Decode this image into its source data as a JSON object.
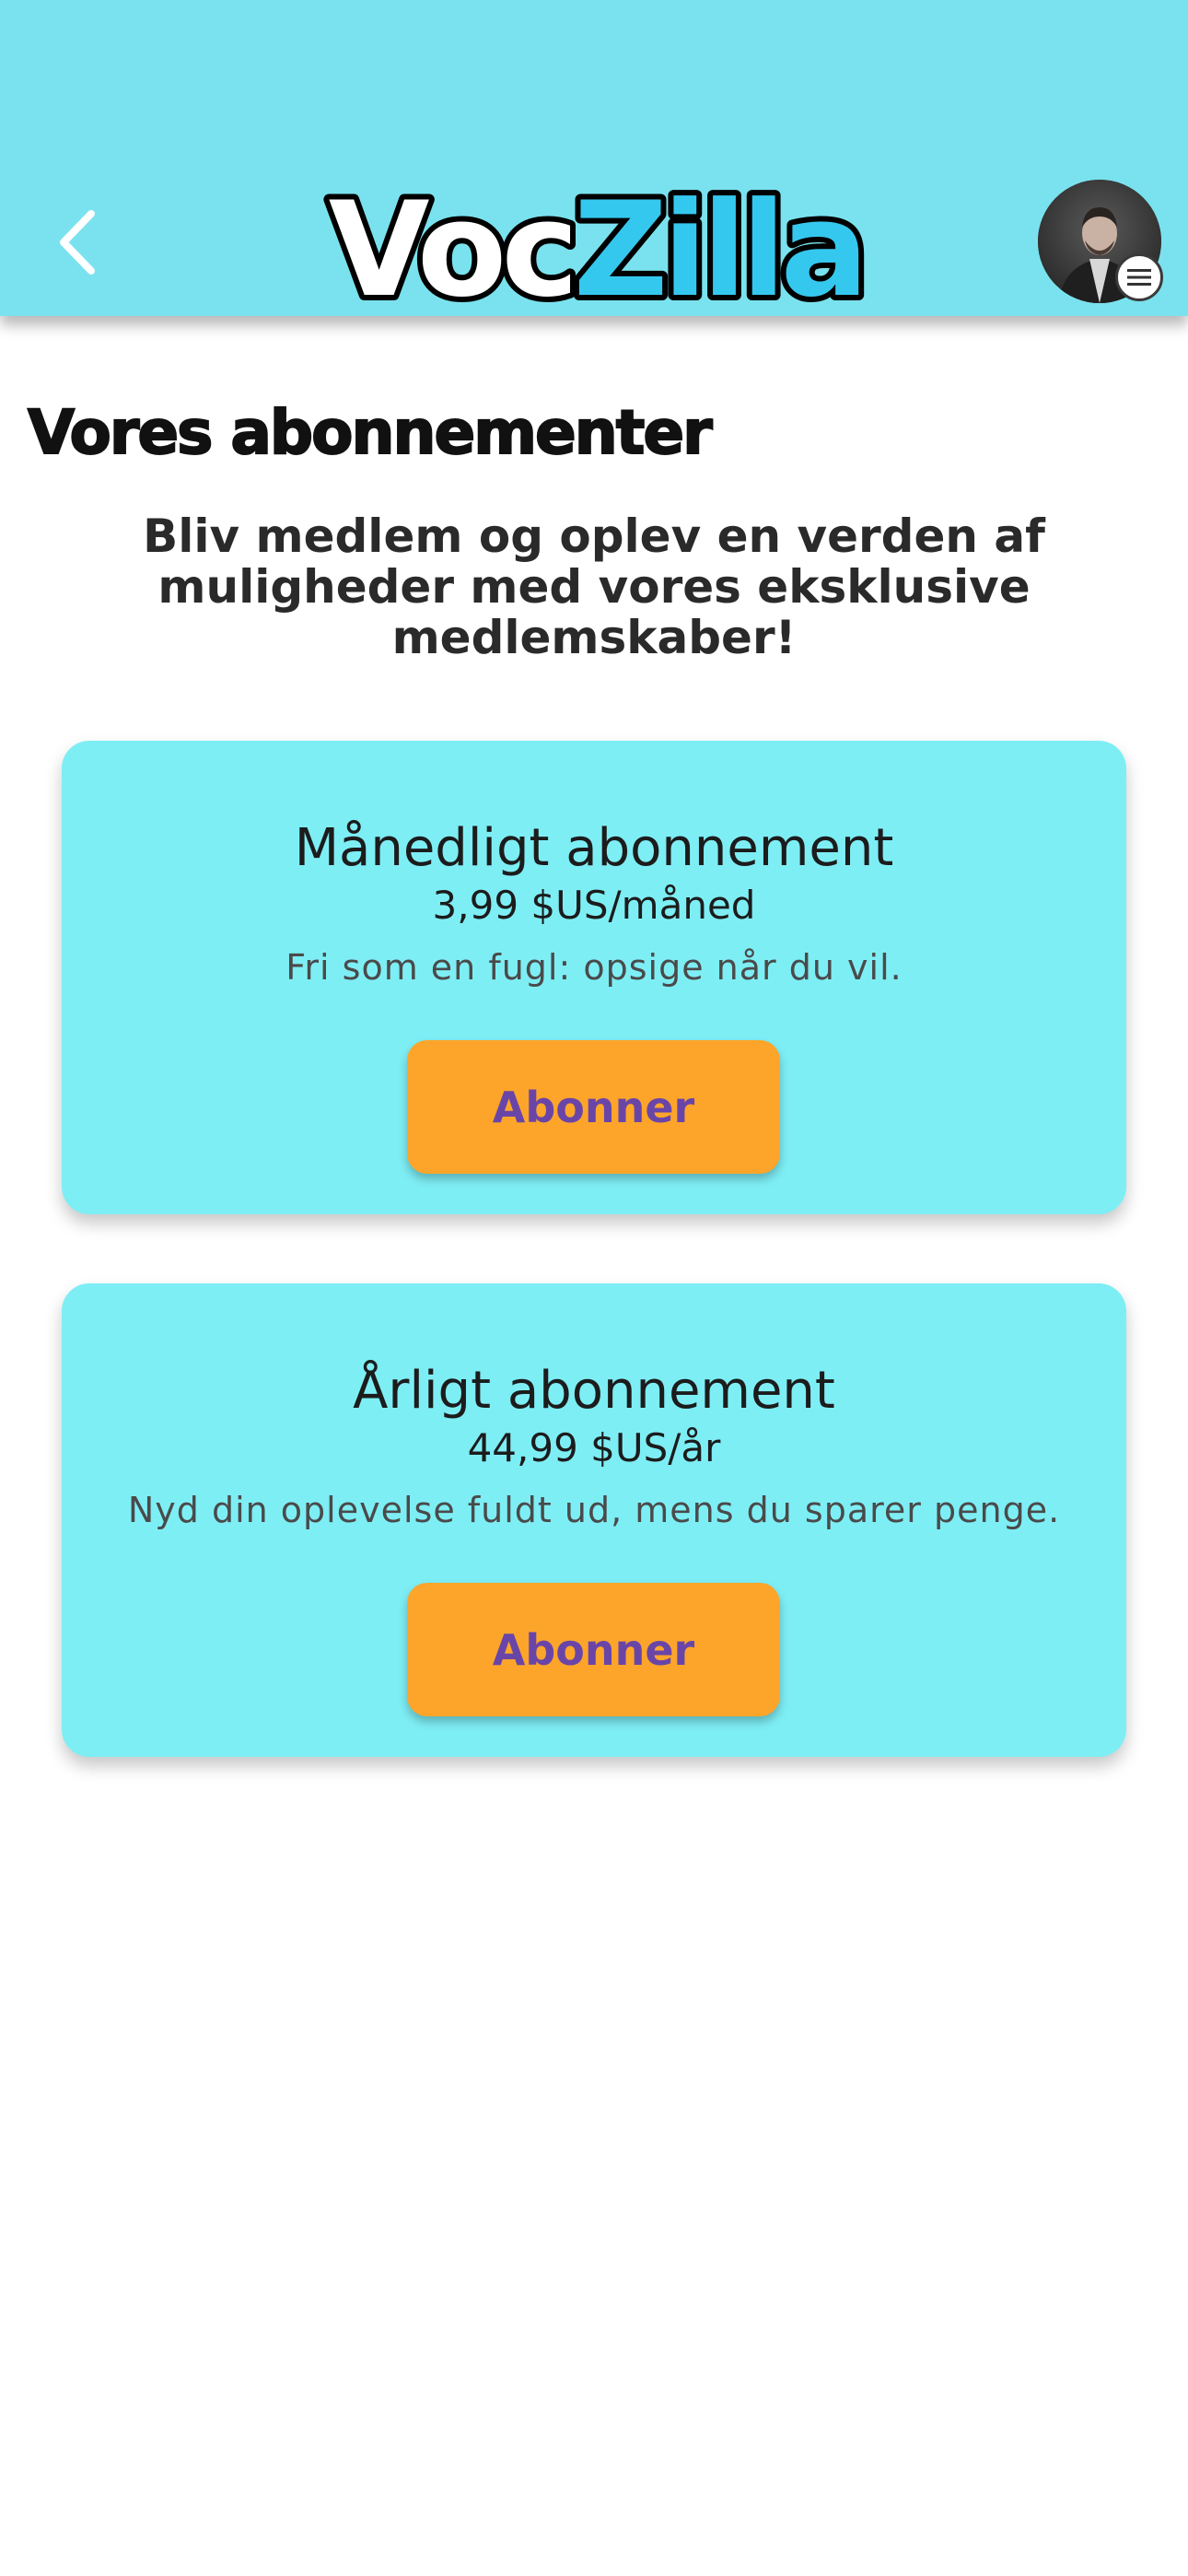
{
  "header": {
    "back_icon": "chevron-left-icon",
    "logo_text_primary": "Voc",
    "logo_text_secondary": "Zilla",
    "avatar_badge_icon": "menu-icon",
    "colors": {
      "background": "#7ae2ee",
      "logo_primary": "#ffffff",
      "logo_secondary": "#35c8ef",
      "logo_outline": "#000000"
    }
  },
  "page": {
    "title": "Vores abonnementer",
    "intro": "Bliv medlem og oplev en verden af muligheder med vores eksklusive medlemskaber!"
  },
  "plans": [
    {
      "name": "Månedligt abonnement",
      "price": "3,99 $US/måned",
      "description": "Fri som en fugl: opsige når du vil.",
      "button_label": "Abonner"
    },
    {
      "name": "Årligt abonnement",
      "price": "44,99 $US/år",
      "description": "Nyd din oplevelse fuldt ud, mens du sparer penge.",
      "button_label": "Abonner"
    }
  ],
  "colors": {
    "card": "#7eeef5",
    "button": "#fda52a",
    "button_text": "#6a45a8"
  }
}
